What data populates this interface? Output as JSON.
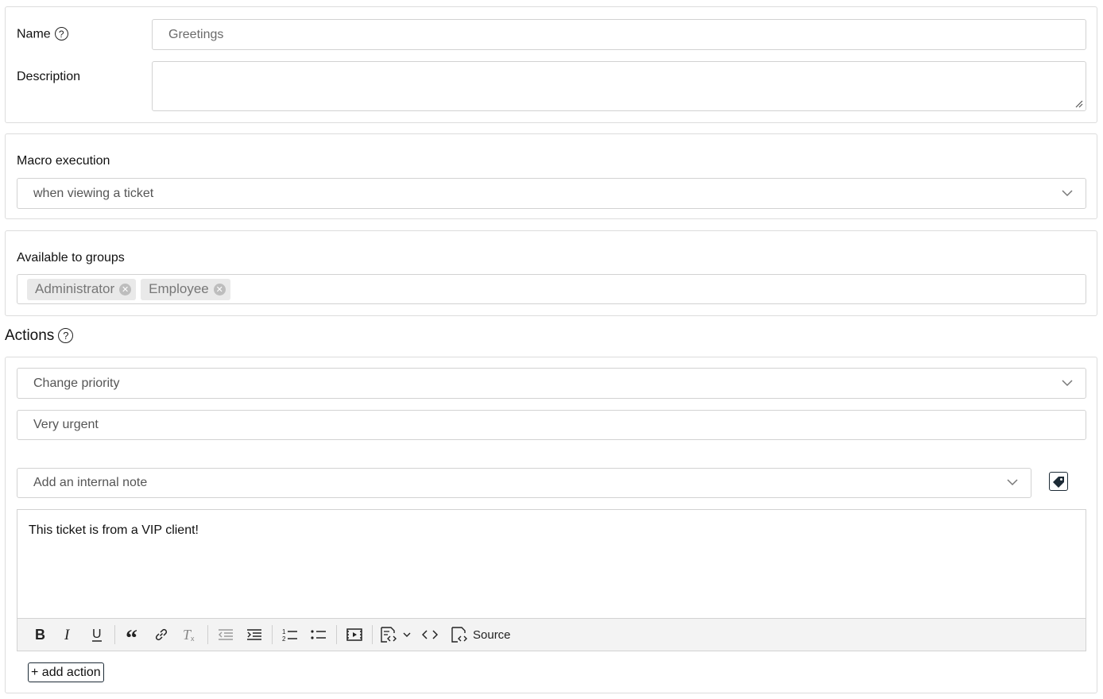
{
  "name_section": {
    "name_label": "Name",
    "name_value": "Greetings",
    "description_label": "Description",
    "description_value": ""
  },
  "execution_section": {
    "label": "Macro execution",
    "selected": "when viewing a ticket"
  },
  "groups_section": {
    "label": "Available to groups",
    "chips": [
      "Administrator",
      "Employee"
    ]
  },
  "actions_section": {
    "title": "Actions",
    "action1_type": "Change priority",
    "action1_value": "Very urgent",
    "action2_type": "Add an internal note",
    "note_text": "This ticket is from a VIP client!",
    "source_label": "Source",
    "add_action_label": "+ add action"
  }
}
